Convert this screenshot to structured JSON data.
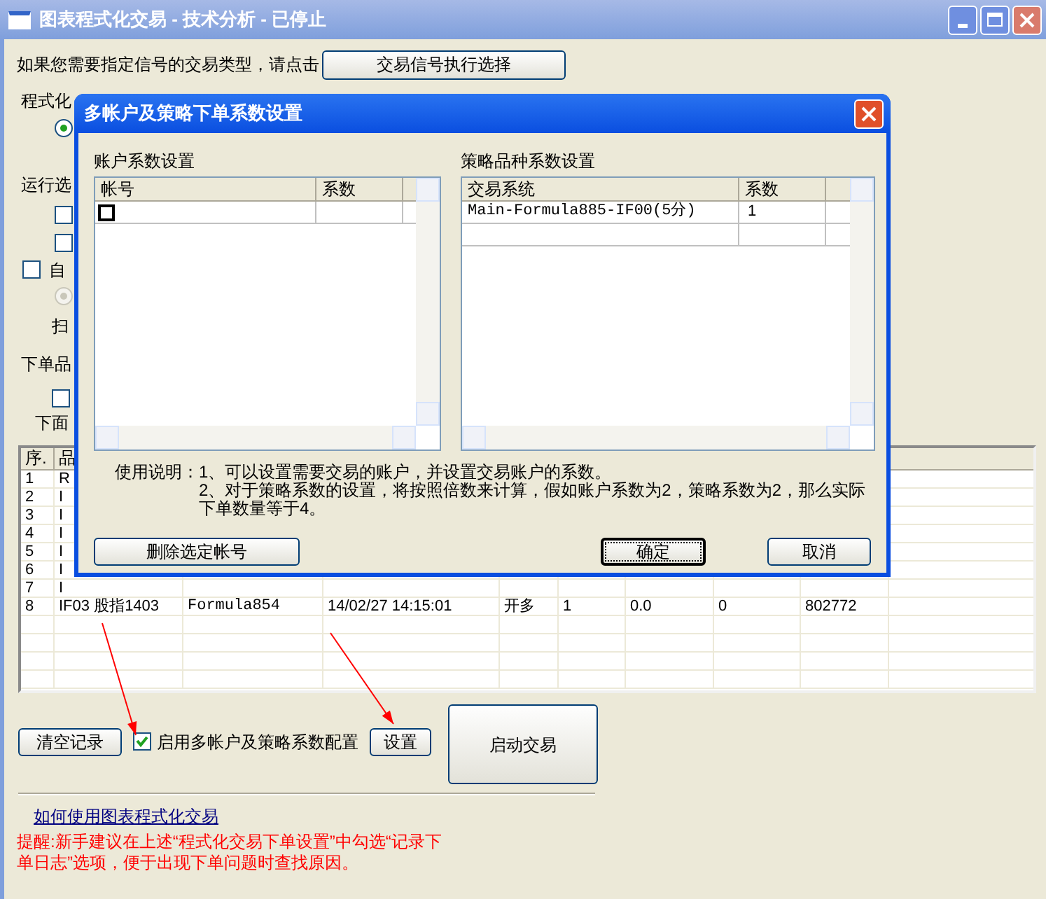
{
  "window": {
    "title": "图表程式化交易 - 技术分析 - 已停止"
  },
  "signal_prompt": {
    "text": "如果您需要指定信号的交易类型，请点击",
    "button": "交易信号执行选择"
  },
  "form_fragments": [
    {
      "kind": "label",
      "text": "程式化"
    },
    {
      "kind": "radio",
      "selected": true,
      "disabled": false
    },
    {
      "kind": "label",
      "text": "运行选"
    },
    {
      "kind": "checkbox",
      "checked": false
    },
    {
      "kind": "checkbox",
      "checked": false
    },
    {
      "kind": "checkbox",
      "checked": false,
      "text": "自"
    },
    {
      "kind": "radio",
      "selected": true,
      "disabled": true
    },
    {
      "kind": "label",
      "text": "扫"
    },
    {
      "kind": "label",
      "text": "下单品"
    },
    {
      "kind": "checkbox",
      "checked": false
    },
    {
      "kind": "label",
      "text": "下面"
    }
  ],
  "table": {
    "columns": [
      "序.",
      "品"
    ],
    "rows": [
      {
        "cells": [
          "1",
          "R"
        ]
      },
      {
        "cells": [
          "2",
          "I"
        ]
      },
      {
        "cells": [
          "3",
          "I"
        ]
      },
      {
        "cells": [
          "4",
          "I"
        ]
      },
      {
        "cells": [
          "5",
          "I"
        ]
      },
      {
        "cells": [
          "6",
          "I"
        ]
      },
      {
        "cells": [
          "7",
          "I"
        ]
      },
      {
        "cells": [
          "8",
          "IF03 股指1403",
          "Formula854",
          "14/02/27 14:15:01",
          "开多",
          "1",
          "0.0",
          "0",
          "802772"
        ]
      }
    ]
  },
  "clear_button": "清空记录",
  "multi_account": {
    "label": "启用多帐户及策略系数配置",
    "checked": true
  },
  "settings_button": "设置",
  "start_button": "启动交易",
  "help_link": "如何使用图表程式化交易",
  "tip": "提醒:新手建议在上述“程式化交易下单设置”中勾选“记录下单日志”选项，便于出现下单问题时查找原因。",
  "dialog": {
    "title": "多帐户及策略下单系数设置",
    "account_panel": {
      "title": "账户系数设置",
      "columns": [
        "帐号",
        "系数"
      ],
      "rows": [
        {
          "checked": false
        }
      ]
    },
    "strategy_panel": {
      "title": "策略品种系数设置",
      "columns": [
        "交易系统",
        "系数"
      ],
      "rows": [
        {
          "system": "Main-Formula885-IF00(5分)",
          "coef": "1"
        }
      ]
    },
    "instructions": {
      "label": "使用说明：",
      "lines": [
        "1、可以设置需要交易的账户，并设置交易账户的系数。",
        "2、对于策略系数的设置，将按照倍数来计算，假如账户系数为2，策略系数为2，那么实际下单数量等于4。"
      ]
    },
    "buttons": [
      {
        "label": "删除选定帐号",
        "default": false
      },
      {
        "label": "确定",
        "default": true
      },
      {
        "label": "取消",
        "default": false
      }
    ]
  }
}
